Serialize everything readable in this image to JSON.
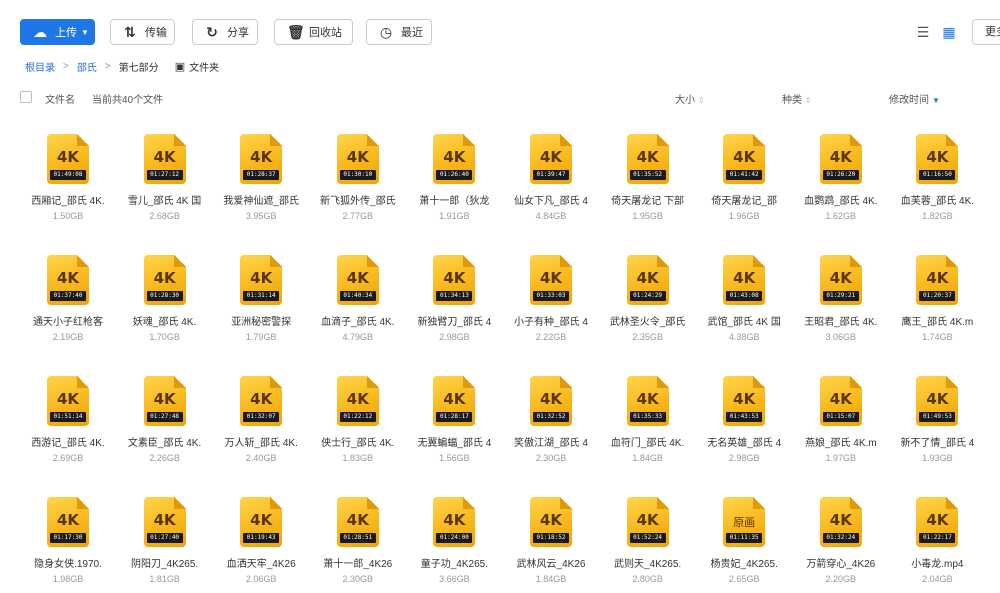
{
  "toolbar": {
    "upload": "上传",
    "transfer": "传输",
    "share": "分享",
    "recycle": "回收站",
    "recent": "最近",
    "more": "更多"
  },
  "icons": {
    "upload": "cloud-upload-icon",
    "transfer": "transfer-icon",
    "share": "share-icon",
    "recycle": "trash-icon",
    "recent": "clock-icon",
    "list_view": "list-view-icon",
    "grid_view": "grid-view-icon"
  },
  "breadcrumb": {
    "root": "根目录",
    "level1": "邵氏",
    "current": "第七部分",
    "folder_label": "文件夹"
  },
  "header": {
    "name": "文件名",
    "count": "当前共40个文件",
    "size": "大小",
    "type": "种类",
    "modified": "修改时间"
  },
  "accent": "#1f76e6",
  "files": [
    {
      "badge": "4K",
      "duration": "01:49:08",
      "name": "西厢记_邵氏 4K.",
      "size": "1.50GB"
    },
    {
      "badge": "4K",
      "duration": "01:27:12",
      "name": "雪儿_邵氏 4K 国",
      "size": "2.68GB"
    },
    {
      "badge": "4K",
      "duration": "01:28:37",
      "name": "我爱神仙遮_邵氏",
      "size": "3.95GB"
    },
    {
      "badge": "4K",
      "duration": "01:30:10",
      "name": "新飞狐外传_邵氏",
      "size": "2.77GB"
    },
    {
      "badge": "4K",
      "duration": "01:26:40",
      "name": "萧十一郎（狄龙",
      "size": "1.91GB"
    },
    {
      "badge": "4K",
      "duration": "01:39:47",
      "name": "仙女下凡_邵氏 4",
      "size": "4.84GB"
    },
    {
      "badge": "4K",
      "duration": "01:35:52",
      "name": "倚天屠龙记 下部",
      "size": "1.95GB"
    },
    {
      "badge": "4K",
      "duration": "01:41:42",
      "name": "倚天屠龙记_邵",
      "size": "1.96GB"
    },
    {
      "badge": "4K",
      "duration": "01:26:20",
      "name": "血鹦鹉_邵氏 4K.",
      "size": "1.62GB"
    },
    {
      "badge": "4K",
      "duration": "01:16:50",
      "name": "血芙蓉_邵氏 4K.",
      "size": "1.82GB"
    },
    {
      "badge": "4K",
      "duration": "01:37:40",
      "name": "通天小子红枪客",
      "size": "2.19GB"
    },
    {
      "badge": "4K",
      "duration": "01:28:30",
      "name": "妖魂_邵氏 4K.",
      "size": "1.70GB"
    },
    {
      "badge": "4K",
      "duration": "01:31:14",
      "name": "亚洲秘密警探",
      "size": "1.79GB"
    },
    {
      "badge": "4K",
      "duration": "01:40:34",
      "name": "血滴子_邵氏 4K.",
      "size": "4.79GB"
    },
    {
      "badge": "4K",
      "duration": "01:34:13",
      "name": "新独臂刀_邵氏 4",
      "size": "2.98GB"
    },
    {
      "badge": "4K",
      "duration": "01:33:03",
      "name": "小子有种_邵氏 4",
      "size": "2.22GB"
    },
    {
      "badge": "4K",
      "duration": "01:24:29",
      "name": "武林圣火令_邵氏",
      "size": "2.35GB"
    },
    {
      "badge": "4K",
      "duration": "01:43:08",
      "name": "武馆_邵氏 4K 国",
      "size": "4.38GB"
    },
    {
      "badge": "4K",
      "duration": "01:29:21",
      "name": "王昭君_邵氏 4K.",
      "size": "3.06GB"
    },
    {
      "badge": "4K",
      "duration": "01:20:37",
      "name": "鹰王_邵氏 4K.m",
      "size": "1.74GB"
    },
    {
      "badge": "4K",
      "duration": "01:51:14",
      "name": "西游记_邵氏 4K.",
      "size": "2.69GB"
    },
    {
      "badge": "4K",
      "duration": "01:27:48",
      "name": "文素臣_邵氏 4K.",
      "size": "2.26GB"
    },
    {
      "badge": "4K",
      "duration": "01:32:07",
      "name": "万人斩_邵氏 4K.",
      "size": "2.40GB"
    },
    {
      "badge": "4K",
      "duration": "01:22:12",
      "name": "侠士行_邵氏 4K.",
      "size": "1.83GB"
    },
    {
      "badge": "4K",
      "duration": "01:28:17",
      "name": "无翼蝙蝠_邵氏 4",
      "size": "1.56GB"
    },
    {
      "badge": "4K",
      "duration": "01:32:52",
      "name": "笑傲江湖_邵氏 4",
      "size": "2.30GB"
    },
    {
      "badge": "4K",
      "duration": "01:35:33",
      "name": "血符门_邵氏 4K.",
      "size": "1.84GB"
    },
    {
      "badge": "4K",
      "duration": "01:43:53",
      "name": "无名英雄_邵氏 4",
      "size": "2.98GB"
    },
    {
      "badge": "4K",
      "duration": "01:15:07",
      "name": "燕娘_邵氏 4K.m",
      "size": "1.97GB"
    },
    {
      "badge": "4K",
      "duration": "01:49:53",
      "name": "新不了情_邵氏 4",
      "size": "1.93GB"
    },
    {
      "badge": "4K",
      "duration": "01:17:30",
      "name": "隐身女侠.1970.",
      "size": "1.98GB"
    },
    {
      "badge": "4K",
      "duration": "01:27:40",
      "name": "阴阳刀_4K265.",
      "size": "1.81GB"
    },
    {
      "badge": "4K",
      "duration": "01:19:43",
      "name": "血洒天牢_4K26",
      "size": "2.06GB"
    },
    {
      "badge": "4K",
      "duration": "01:28:51",
      "name": "萧十一郎_4K26",
      "size": "2.30GB"
    },
    {
      "badge": "4K",
      "duration": "01:24:00",
      "name": "童子功_4K265.",
      "size": "3.66GB"
    },
    {
      "badge": "4K",
      "duration": "01:18:52",
      "name": "武林风云_4K26",
      "size": "1.84GB"
    },
    {
      "badge": "4K",
      "duration": "01:52:24",
      "name": "武则天_4K265.",
      "size": "2.80GB"
    },
    {
      "badge": "原画",
      "duration": "01:11:35",
      "name": "杨贵妃_4K265.",
      "size": "2.65GB"
    },
    {
      "badge": "4K",
      "duration": "01:32:24",
      "name": "万箭穿心_4K26",
      "size": "2.20GB"
    },
    {
      "badge": "4K",
      "duration": "01:22:17",
      "name": "小毒龙.mp4",
      "size": "2.04GB"
    }
  ]
}
